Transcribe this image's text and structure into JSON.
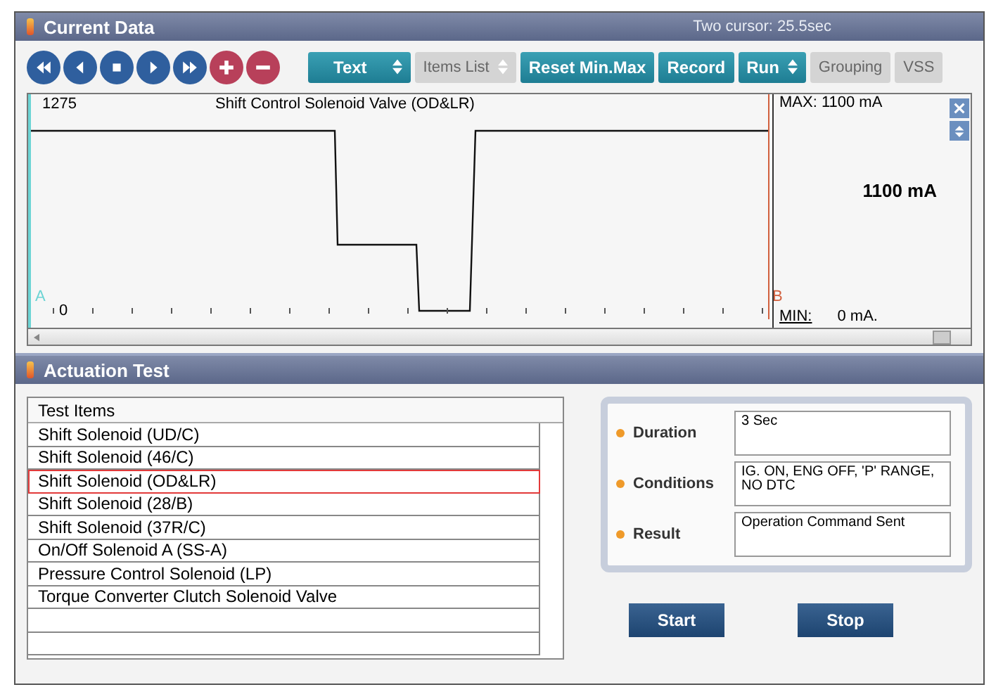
{
  "current_data": {
    "title": "Current Data",
    "cursor_info": "Two cursor: 25.5sec",
    "media_buttons": [
      {
        "kind": "rewind"
      },
      {
        "kind": "back"
      },
      {
        "kind": "stop"
      },
      {
        "kind": "play"
      },
      {
        "kind": "forward"
      },
      {
        "kind": "add"
      },
      {
        "kind": "remove"
      }
    ],
    "toolbar": [
      {
        "label": "Text",
        "dropdown": true,
        "disabled": false
      },
      {
        "label": "Items List",
        "dropdown": true,
        "disabled": true
      },
      {
        "label": "Reset Min.Max",
        "dropdown": false,
        "disabled": false
      },
      {
        "label": "Record",
        "dropdown": false,
        "disabled": false
      },
      {
        "label": "Run",
        "dropdown": true,
        "disabled": false
      },
      {
        "label": "Grouping",
        "dropdown": false,
        "disabled": true
      },
      {
        "label": "VSS",
        "dropdown": false,
        "disabled": true
      }
    ],
    "graph": {
      "top_value": "1275",
      "signal": "Shift Control Solenoid Valve (OD&LR)",
      "bottom_value": "0",
      "cursor_a": "A",
      "cursor_b": "B",
      "max": "MAX:  1100 mA",
      "current": "1100 mA",
      "min_label": "MIN:",
      "min_value": "0 mA."
    }
  },
  "actuation_test": {
    "title": "Actuation Test",
    "list_header": "Test Items",
    "items": [
      {
        "label": "Shift Solenoid (UD/C)",
        "selected": false
      },
      {
        "label": "Shift Solenoid (46/C)",
        "selected": false
      },
      {
        "label": "Shift Solenoid (OD&LR)",
        "selected": true
      },
      {
        "label": "Shift Solenoid (28/B)",
        "selected": false
      },
      {
        "label": "Shift Solenoid (37R/C)",
        "selected": false
      },
      {
        "label": "On/Off Solenoid A (SS-A)",
        "selected": false
      },
      {
        "label": "Pressure Control Solenoid (LP)",
        "selected": false
      },
      {
        "label": "Torque Converter Clutch Solenoid Valve",
        "selected": false
      }
    ],
    "details": [
      {
        "label": "Duration",
        "value": "3 Sec"
      },
      {
        "label": "Conditions",
        "value": "IG. ON, ENG OFF, 'P' RANGE, NO DTC"
      },
      {
        "label": "Result",
        "value": "Operation Command Sent"
      }
    ],
    "buttons": [
      "Start",
      "Stop"
    ]
  }
}
